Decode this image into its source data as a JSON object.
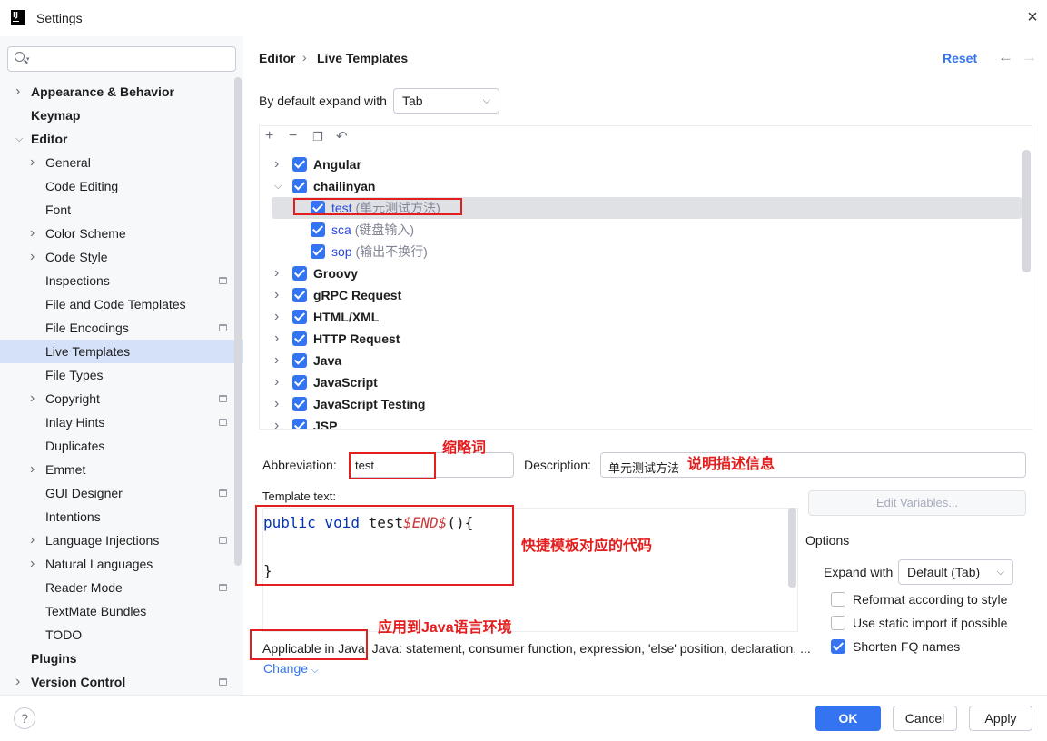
{
  "window": {
    "title": "Settings",
    "logo_text": "IJ"
  },
  "sidebar": {
    "search_placeholder": "",
    "items": [
      {
        "label": "Appearance & Behavior",
        "level": 0,
        "bold": true,
        "chevron": true,
        "expanded": false
      },
      {
        "label": "Keymap",
        "level": 0,
        "bold": true
      },
      {
        "label": "Editor",
        "level": 0,
        "bold": true,
        "chevron": true,
        "expanded": true
      },
      {
        "label": "General",
        "level": 1,
        "chevron": true
      },
      {
        "label": "Code Editing",
        "level": 1
      },
      {
        "label": "Font",
        "level": 1
      },
      {
        "label": "Color Scheme",
        "level": 1,
        "chevron": true
      },
      {
        "label": "Code Style",
        "level": 1,
        "chevron": true
      },
      {
        "label": "Inspections",
        "level": 1,
        "project_icon": true
      },
      {
        "label": "File and Code Templates",
        "level": 1
      },
      {
        "label": "File Encodings",
        "level": 1,
        "project_icon": true
      },
      {
        "label": "Live Templates",
        "level": 1,
        "selected": true
      },
      {
        "label": "File Types",
        "level": 1
      },
      {
        "label": "Copyright",
        "level": 1,
        "chevron": true,
        "project_icon": true
      },
      {
        "label": "Inlay Hints",
        "level": 1,
        "project_icon": true
      },
      {
        "label": "Duplicates",
        "level": 1
      },
      {
        "label": "Emmet",
        "level": 1,
        "chevron": true
      },
      {
        "label": "GUI Designer",
        "level": 1,
        "project_icon": true
      },
      {
        "label": "Intentions",
        "level": 1
      },
      {
        "label": "Language Injections",
        "level": 1,
        "chevron": true,
        "project_icon": true
      },
      {
        "label": "Natural Languages",
        "level": 1,
        "chevron": true
      },
      {
        "label": "Reader Mode",
        "level": 1,
        "project_icon": true
      },
      {
        "label": "TextMate Bundles",
        "level": 1
      },
      {
        "label": "TODO",
        "level": 1
      },
      {
        "label": "Plugins",
        "level": 0,
        "bold": true
      },
      {
        "label": "Version Control",
        "level": 0,
        "bold": true,
        "chevron": true,
        "project_icon": true
      }
    ]
  },
  "header": {
    "breadcrumb": [
      "Editor",
      "Live Templates"
    ],
    "separator": "›",
    "reset_label": "Reset"
  },
  "expand_default": {
    "label": "By default expand with",
    "value": "Tab"
  },
  "tree": {
    "toolbar": [
      "add-icon",
      "remove-icon",
      "copy-icon",
      "undo-icon"
    ],
    "rows": [
      {
        "name": "Angular",
        "group": true,
        "expanded": false
      },
      {
        "name": "chailinyan",
        "group": true,
        "expanded": true
      },
      {
        "name": "test",
        "desc": "(单元测试方法)",
        "group": false,
        "selected": true
      },
      {
        "name": "sca",
        "desc": "(键盘输入)",
        "group": false
      },
      {
        "name": "sop",
        "desc": "(输出不换行)",
        "group": false
      },
      {
        "name": "Groovy",
        "group": true
      },
      {
        "name": "gRPC Request",
        "group": true
      },
      {
        "name": "HTML/XML",
        "group": true
      },
      {
        "name": "HTTP Request",
        "group": true
      },
      {
        "name": "Java",
        "group": true
      },
      {
        "name": "JavaScript",
        "group": true
      },
      {
        "name": "JavaScript Testing",
        "group": true
      },
      {
        "name": "JSP",
        "group": true
      }
    ]
  },
  "form": {
    "abbreviation_label": "Abbreviation:",
    "abbreviation_value": "test",
    "description_label": "Description:",
    "description_value": "单元测试方法",
    "template_text_label": "Template text:",
    "code_line1_kw": "public void",
    "code_line1_name": " test",
    "code_line1_var": "$END$",
    "code_line1_tail": "(){",
    "code_line3": "}",
    "edit_variables_label": "Edit Variables...",
    "applicable": "Applicable in Java; Java: statement, consumer function, expression, 'else' position, declaration, ...",
    "change_label": "Change"
  },
  "options": {
    "title": "Options",
    "expand_with_label": "Expand with",
    "expand_with_value": "Default (Tab)",
    "reformat_label": "Reformat according to style",
    "static_import_label": "Use static import if possible",
    "shorten_label": "Shorten FQ names",
    "reformat_checked": false,
    "static_import_checked": false,
    "shorten_checked": true
  },
  "annotations": {
    "abbr_note": "缩略词",
    "desc_note": "说明描述信息",
    "code_note": "快捷模板对应的代码",
    "applic_note": "应用到Java语言环境"
  },
  "buttons": {
    "ok": "OK",
    "cancel": "Cancel",
    "apply": "Apply",
    "help": "?"
  },
  "colors": {
    "accent": "#3574f0",
    "annotation": "#e21e1e",
    "selection": "#d5e1f8"
  }
}
